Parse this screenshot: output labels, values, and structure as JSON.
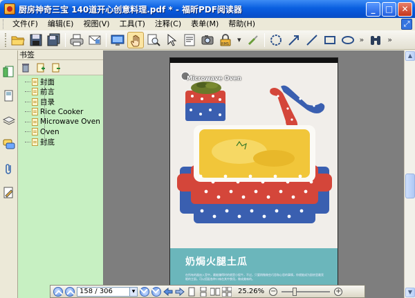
{
  "window": {
    "title": "厨房神奇三宝  140道开心创意料理.pdf * - 福昕PDF阅读器"
  },
  "menu": {
    "items": [
      "文件(F)",
      "编辑(E)",
      "视图(V)",
      "工具(T)",
      "注释(C)",
      "表单(M)",
      "帮助(H)"
    ]
  },
  "toolbar": {
    "icons": [
      "open-folder-icon",
      "save-icon",
      "save-all-icon",
      "print-icon",
      "email-icon",
      "fullscreen-icon",
      "hand-tool-icon",
      "zoom-tool-icon",
      "select-arrow-icon",
      "text-select-icon",
      "snapshot-icon",
      "rms-icon",
      "link-icon",
      "circle-tool-icon",
      "arrow-tool-icon",
      "line-tool-icon",
      "rectangle-tool-icon",
      "ellipse-tool-icon",
      "binoculars-icon"
    ]
  },
  "panel": {
    "header": "书签",
    "bookmarks": [
      "封面",
      "前言",
      "目录",
      "Rice Cooker",
      "Microwave Oven",
      "Oven",
      "封底"
    ]
  },
  "page": {
    "section_label": "Microwave Oven",
    "dish_title": "奶焗火腿土瓜",
    "description": "在所有的器皿入室中，最能赚得时的就是小饭牛，不过，只要稍微做些巧思和心思的事情，你就能成为厨房里最亮眼的主厨。可以搭配各种口味在其中食用，做成美味的。"
  },
  "navigation": {
    "page_display": "158 / 306",
    "zoom": "25.26%",
    "zoom_fraction": 0.2526
  },
  "colors": {
    "titlebar": "#0a5fe0",
    "bookmark_panel": "#c7f0c2",
    "doc_background": "#7e7e7e",
    "page_bottom": "#6bb6bb"
  }
}
